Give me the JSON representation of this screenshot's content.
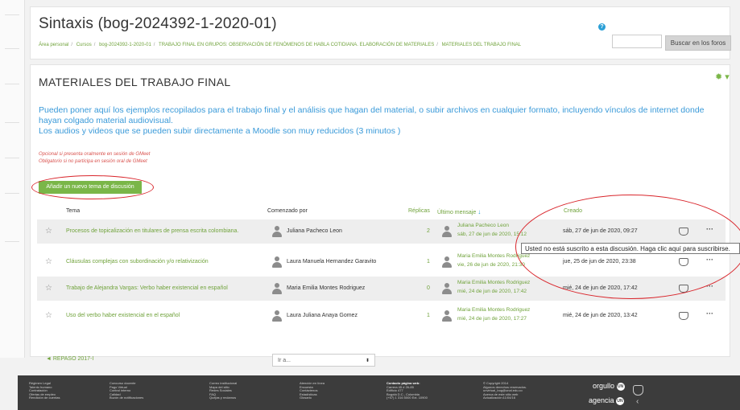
{
  "header": {
    "course_title": "Sintaxis (bog-2024392-1-2020-01)",
    "breadcrumb": [
      "Área personal",
      "Cursos",
      "bog-2024392-1-2020-01",
      "TRABAJO FINAL EN GRUPOS: OBSERVACIÓN DE FENÓMENOS DE HABLA COTIDIANA. ELABORACIÓN DE MATERIALES",
      "MATERIALES DEL TRABAJO FINAL"
    ],
    "help_glyph": "?",
    "search_placeholder": "",
    "search_button": "Buscar en los foros"
  },
  "forum": {
    "title": "MATERIALES DEL TRABAJO FINAL",
    "description_1": "Pueden poner aquí los ejemplos recopilados para el trabajo final y el análisis que hagan del material,  o subir archivos en cualquier formato, incluyendo vínculos de internet donde hayan colgado material audiovisual.",
    "description_2": "Los audios y videos que se pueden subir directamente a Moodle son muy reducidos (3 minutos )",
    "note_1": "Opcional si presenta oralmente en sesión de GMeet",
    "note_2": "Obligatorio si no participa en sesión oral de GMeet",
    "add_button": "Añadir un nuevo tema de discusión"
  },
  "table": {
    "headers": {
      "topic": "Tema",
      "started_by": "Comenzado por",
      "replies": "Réplicas",
      "last_post": "Último mensaje",
      "created": "Creado"
    },
    "rows": [
      {
        "topic": "Procesos de topicalización en titulares de prensa escrita colombiana.",
        "author": "Juliana Pacheco Leon",
        "replies": "2",
        "last_name": "Juliana Pacheco Leon",
        "last_date": "sáb, 27 de jun de 2020, 15:12",
        "created": "sáb, 27 de jun de 2020, 09:27"
      },
      {
        "topic": "Cláusulas complejas con subordinación y/o relativización",
        "author": "Laura Manuela Hernandez Garavito",
        "replies": "1",
        "last_name": "Maria Emilia Montes Rodriguez",
        "last_date": "vie, 26 de jun de 2020, 21:30",
        "created": "jue, 25 de jun de 2020, 23:38"
      },
      {
        "topic": "Trabajo de Alejandra Vargas: Verbo haber existencial en español",
        "author": "Maria Emilia Montes Rodriguez",
        "replies": "0",
        "last_name": "Maria Emilia Montes Rodriguez",
        "last_date": "mié, 24 de jun de 2020, 17:42",
        "created": "mié, 24 de jun de 2020, 17:42"
      },
      {
        "topic": "Uso del verbo haber existencial en el español",
        "author": "Laura Juliana Anaya Gomez",
        "replies": "1",
        "last_name": "Maria Emilia Montes Rodriguez",
        "last_date": "mié, 24 de jun de 2020, 17:27",
        "created": "mié, 24 de jun de 2020, 13:42"
      }
    ]
  },
  "tooltip": "Usted no está suscrito a esta discusión. Haga clic aquí para suscribirse.",
  "nav": {
    "previous": "◄ REPASO 2017-I",
    "jump_to": "Ir a..."
  },
  "footer": {
    "col1": [
      "Régimen Legal",
      "Talento humano",
      "Contratación",
      "Ofertas de empleo",
      "Rendición de cuentas"
    ],
    "col2": [
      "Concurso docente",
      "Pago Virtual",
      "Control interno",
      "Calidad",
      "Buzón de notificaciones"
    ],
    "col3": [
      "Correo institucional",
      "Mapa del sitio",
      "Redes Sociales",
      "FAQ",
      "Quejas y reclamos"
    ],
    "col4": [
      "Atención en línea",
      "Encuesta",
      "Contáctenos",
      "Estadísticas",
      "Glosario"
    ],
    "col5": [
      "Contacto página web:",
      "Carrera 45 # 26-85",
      "Edificio 477",
      "Bogotá D.C., Colombia",
      "(+57) 1 316 5000 Ext. 10900"
    ],
    "col6": [
      "© Copyright 2014",
      "Algunos derechos reservados.",
      "unvirtual_bog@unal.edu.co",
      "Acerca de este sitio web",
      "Actualización:11/04/16"
    ],
    "brand_1": "orgullo",
    "brand_2": "agencia",
    "brand_mark": "UN"
  },
  "colors": {
    "accent_green": "#7ab648",
    "link_blue": "#3a9ad9",
    "annotation_red": "#d9262c"
  }
}
